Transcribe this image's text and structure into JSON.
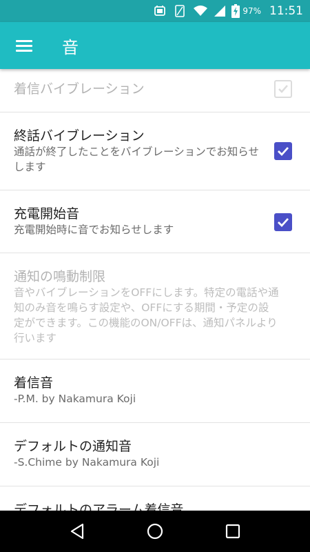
{
  "status_bar": {
    "battery_percent": "97%",
    "time": "11:51",
    "icons": [
      "sim-icon",
      "vibrate-icon",
      "wifi-icon",
      "signal-icon",
      "battery-charging-icon"
    ]
  },
  "app_bar": {
    "title": "音",
    "menu_icon": "menu-icon"
  },
  "settings": [
    {
      "title": "着信バイブレーション",
      "summary": "",
      "checkbox": "checked-disabled",
      "enabled": false
    },
    {
      "title": "終話バイブレーション",
      "summary": "通話が終了したことをバイブレーションでお知らせします",
      "checkbox": "checked",
      "enabled": true
    },
    {
      "title": "充電開始音",
      "summary": "充電開始時に音でお知らせします",
      "checkbox": "checked",
      "enabled": true
    },
    {
      "title": "通知の鳴動制限",
      "summary": "音やバイブレーションをOFFにします。特定の電話や通知のみ音を鳴らす設定や、OFFにする期間・予定の設定ができます。この機能のON/OFFは、通知パネルより行います",
      "enabled": false
    },
    {
      "title": "着信音",
      "summary": "-P.M. by Nakamura Koji",
      "enabled": true
    },
    {
      "title": "デフォルトの通知音",
      "summary": "-S.Chime by Nakamura Koji",
      "enabled": true
    },
    {
      "title": "デフォルトのアラーム着信音",
      "summary": "",
      "enabled": true
    }
  ],
  "nav_bar": {
    "icons": [
      "back-icon",
      "home-icon",
      "recents-icon"
    ]
  },
  "colors": {
    "status_bar": "#1fa4a8",
    "app_bar": "#1fbcc2",
    "checkbox_checked": "#4a4fc7",
    "nav_bar": "#000000"
  }
}
